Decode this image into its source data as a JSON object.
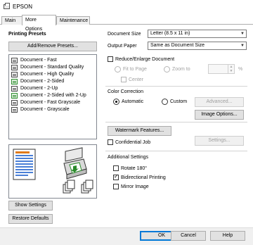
{
  "window": {
    "title": "EPSON"
  },
  "tabs": [
    {
      "label": "Main"
    },
    {
      "label": "More Options"
    },
    {
      "label": "Maintenance"
    }
  ],
  "left": {
    "heading": "Printing Presets",
    "add_remove_button": "Add/Remove Presets...",
    "presets": [
      {
        "label": "Document - Fast",
        "icon": "printer-document-icon"
      },
      {
        "label": "Document - Standard Quality",
        "icon": "printer-document-icon"
      },
      {
        "label": "Document - High Quality",
        "icon": "printer-document-icon"
      },
      {
        "label": "Document - 2-Sided",
        "icon": "eco-duplex-icon"
      },
      {
        "label": "Document - 2-Up",
        "icon": "printer-document-icon"
      },
      {
        "label": "Document - 2-Sided with 2-Up",
        "icon": "eco-duplex-icon"
      },
      {
        "label": "Document - Fast Grayscale",
        "icon": "printer-document-icon"
      },
      {
        "label": "Document - Grayscale",
        "icon": "printer-document-icon"
      }
    ],
    "show_settings": "Show Settings",
    "restore_defaults": "Restore Defaults"
  },
  "right": {
    "document_size_label": "Document Size",
    "document_size_value": "Letter (8.5 x 11 in)",
    "output_paper_label": "Output Paper",
    "output_paper_value": "Same as Document Size",
    "reduce_enlarge": {
      "label": "Reduce/Enlarge Document",
      "checked": false
    },
    "fit_to_page": "Fit to Page",
    "zoom_to": "Zoom to",
    "center": "Center",
    "percent": "%",
    "color_correction_label": "Color Correction",
    "automatic": "Automatic",
    "custom": "Custom",
    "advanced_button": "Advanced...",
    "image_options_button": "Image Options...",
    "watermark_button": "Watermark Features...",
    "confidential_job": "Confidential Job",
    "settings_button": "Settings...",
    "additional_settings_label": "Additional Settings",
    "rotate_180": "Rotate 180°",
    "bidirectional_printing": "Bidirectional Printing",
    "mirror_image": "Mirror Image"
  },
  "footer": {
    "ok": "OK",
    "cancel": "Cancel",
    "help": "Help"
  },
  "colors": {
    "accent": "#0078d7",
    "eco_green": "#2a8a2a",
    "disabled_text": "#a0a0a0"
  }
}
